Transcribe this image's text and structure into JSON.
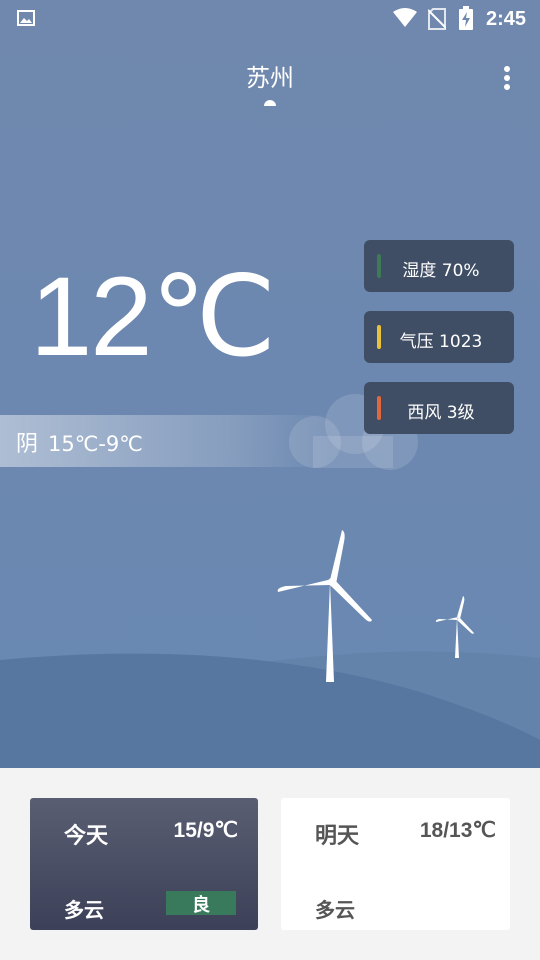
{
  "status_bar": {
    "time": "2:45"
  },
  "header": {
    "city": "苏州"
  },
  "current": {
    "temperature": "12℃",
    "condition": "阴",
    "range": "15℃-9℃"
  },
  "info_cards": [
    {
      "label": "湿度 70%",
      "color": "#3e7a58"
    },
    {
      "label": "气压 1023",
      "color": "#e8c23a"
    },
    {
      "label": "西风 3级",
      "color": "#e0683a"
    }
  ],
  "forecast": {
    "today": {
      "day": "今天",
      "temp": "15/9℃",
      "condition": "多云",
      "badge": "良"
    },
    "tomorrow": {
      "day": "明天",
      "temp": "18/13℃",
      "condition": "多云"
    }
  },
  "colors": {
    "sky": "#6c88b0",
    "card_bg": "#3f4e64",
    "today_card": "#4a4f66",
    "air_badge": "#3a7a5c"
  }
}
